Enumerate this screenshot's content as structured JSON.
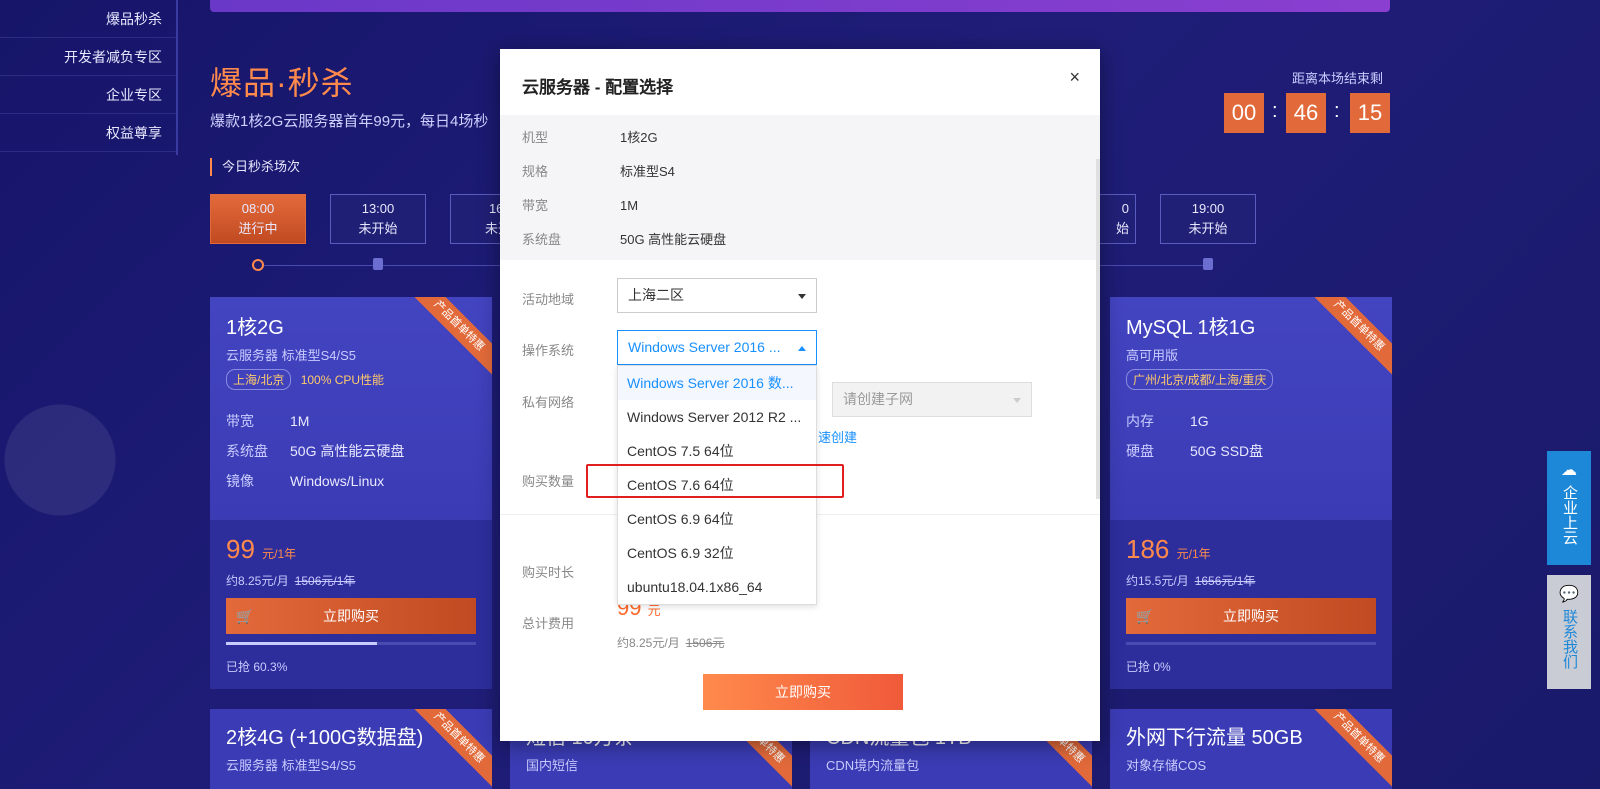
{
  "left_nav": [
    "爆品秒杀",
    "开发者减负专区",
    "企业专区",
    "权益尊享"
  ],
  "hero": {
    "title": "爆品·秒杀",
    "subtitle": "爆款1核2G云服务器首年99元，每日4场秒",
    "sessions_label": "今日秒杀场次"
  },
  "countdown": {
    "label": "距离本场结束剩",
    "hh": "00",
    "mm": "46",
    "ss": "15",
    "sep": ":"
  },
  "slots": [
    {
      "time": "08:00",
      "status": "进行中"
    },
    {
      "time": "13:00",
      "status": "未开始"
    },
    {
      "time": "16:",
      "status": "未开"
    },
    {
      "time": "0",
      "status": "始"
    },
    {
      "time": "19:00",
      "status": "未开始"
    }
  ],
  "cards": [
    {
      "ribbon": "产品首单特惠",
      "title": "1核2G",
      "subtitle": "云服务器 标准型S4/S5",
      "tag": "上海/北京",
      "tag_extra": "100% CPU性能",
      "specs": [
        {
          "k": "带宽",
          "v": "1M"
        },
        {
          "k": "系统盘",
          "v": "50G 高性能云硬盘"
        },
        {
          "k": "镜像",
          "v": "Windows/Linux"
        }
      ],
      "price": "99",
      "price_unit": "元/1年",
      "monthly": "约8.25元/月",
      "original": "1506元/1年",
      "buy": "立即购买",
      "progress": 0.603,
      "sold": "已抢 60.3%"
    },
    {
      "ribbon": "产品首单特惠",
      "title": "MySQL 1核1G",
      "subtitle": "高可用版",
      "tag": "广州/北京/成都/上海/重庆",
      "tag_extra": "",
      "specs": [
        {
          "k": "内存",
          "v": "1G"
        },
        {
          "k": "硬盘",
          "v": "50G SSD盘"
        }
      ],
      "price": "186",
      "price_unit": "元/1年",
      "monthly": "约15.5元/月",
      "original": "1656元/1年",
      "buy": "立即购买",
      "progress": 0,
      "sold": "已抢 0%"
    }
  ],
  "cards_row2": [
    {
      "title": "2核4G (+100G数据盘)",
      "subtitle": "云服务器 标准型S4/S5",
      "ribbon": "产品首单特惠"
    },
    {
      "title": "短信 10万条",
      "subtitle": "国内短信",
      "ribbon": "产品首单特惠"
    },
    {
      "title": "CDN流量包 1TB",
      "subtitle": "CDN境内流量包",
      "ribbon": "产品首单特惠"
    },
    {
      "title": "外网下行流量 50GB",
      "subtitle": "对象存储COS",
      "ribbon": "产品首单特惠"
    }
  ],
  "side_buttons": [
    {
      "icon": "cloud-upload-icon",
      "label": "企业上云",
      "color": "#1e88d8"
    },
    {
      "icon": "chat-icon",
      "label": "联系我们",
      "color": "#bfc3cc"
    }
  ],
  "modal": {
    "title": "云服务器 - 配置选择",
    "close": "×",
    "info": [
      {
        "k": "机型",
        "v": "1核2G"
      },
      {
        "k": "规格",
        "v": "标准型S4"
      },
      {
        "k": "带宽",
        "v": "1M"
      },
      {
        "k": "系统盘",
        "v": "50G 高性能云硬盘"
      }
    ],
    "region_label": "活动地域",
    "region_value": "上海二区",
    "os_label": "操作系统",
    "os_value": "Windows Server 2016 ...",
    "os_options": [
      "Windows Server 2016 数...",
      "Windows Server 2012 R2 ...",
      "CentOS 7.5 64位",
      "CentOS 7.6 64位",
      "CentOS 6.9 64位",
      "CentOS 6.9 32位",
      "ubuntu18.04.1x86_64"
    ],
    "vpc_label": "私有网络",
    "subnet_placeholder": "请创建子网",
    "quick_create": "速创建",
    "qty_label": "购买数量",
    "duration_label": "购买时长",
    "total_label": "总计费用",
    "total_value": "99",
    "total_unit": "元",
    "total_monthly": "约8.25元/月",
    "total_original": "1506元",
    "buy": "立即购买"
  }
}
